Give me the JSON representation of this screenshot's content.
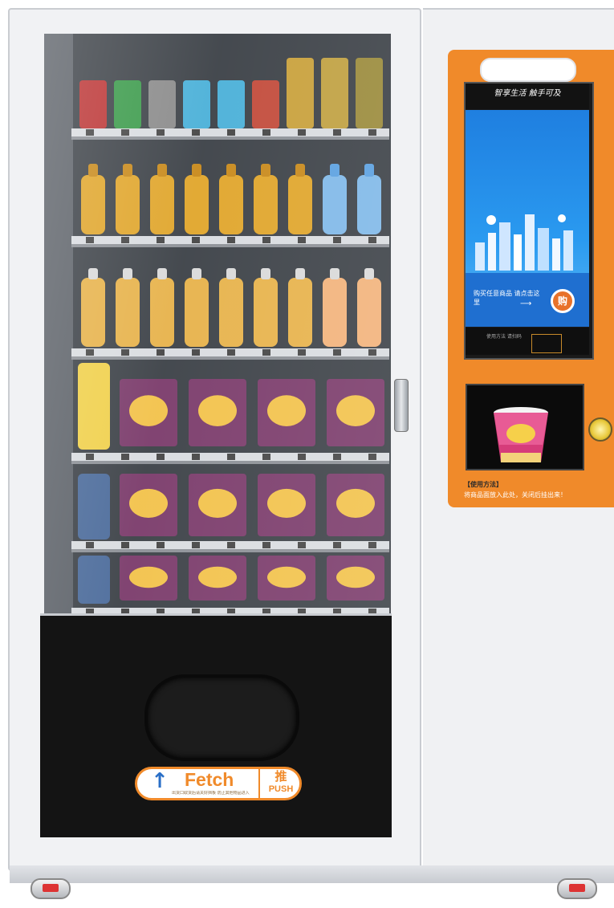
{
  "machine": {
    "screen_title": "智享生活 触手可及",
    "screen_prompt": "购买任意商品 请点击这里",
    "screen_button": "购",
    "screen_footer": "使用方法 请扫码",
    "instruction_title": "【使用方法】",
    "instruction_text": "将商品面放入此处，关闭后挂出来！",
    "fetch_label": "Fetch",
    "fetch_sub": "出货口取货后请关好挡板 防止其他物品进入",
    "push_cn": "推",
    "push_en": "PUSH",
    "colors": {
      "panel": "#f08a2a",
      "screen": "#1f7fe0",
      "cabinet": "#f1f2f4",
      "delivery": "#141414"
    }
  }
}
